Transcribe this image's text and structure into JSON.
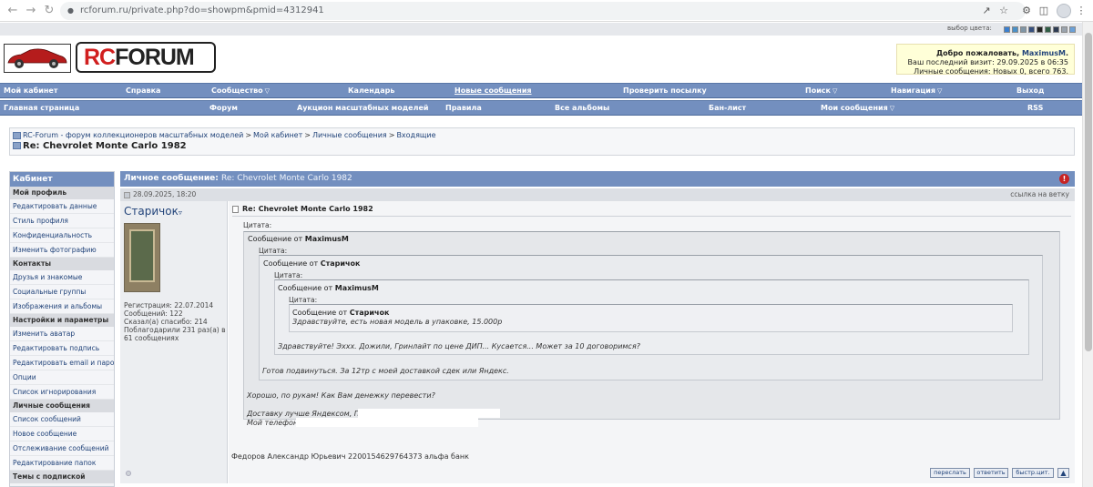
{
  "browser": {
    "back_glyph": "←",
    "forward_glyph": "→",
    "reload_glyph": "↻",
    "url": "rcforum.ru/private.php?do=showpm&pmid=4312941"
  },
  "style_picker": {
    "label": "выбор цвета:",
    "colors": [
      "#3a7fd0",
      "#4a90c8",
      "#7f95a6",
      "#354f7e",
      "#222222",
      "#2f5d45",
      "#2d3b52",
      "#9aa3ad",
      "#6aa0d8"
    ]
  },
  "header": {
    "logo_rc": "RC",
    "logo_forum": "FORUM",
    "welcome_prefix": "Добро пожаловать, ",
    "username": "MaximusM",
    "welcome_suffix": ".",
    "last_visit": "Ваш последний визит: 29.09.2025 в 06:35",
    "messages": "Личные сообщения: Новых 0, всего 763."
  },
  "nav_row1": [
    {
      "label": "Мой кабинет",
      "caret": false,
      "underline": false
    },
    {
      "label": "Справка",
      "caret": false,
      "underline": false
    },
    {
      "label": "Сообщество",
      "caret": true,
      "underline": false
    },
    {
      "label": "Календарь",
      "caret": false,
      "underline": false
    },
    {
      "label": "Новые сообщения",
      "caret": false,
      "underline": true
    },
    {
      "label": "Проверить посылку",
      "caret": false,
      "underline": false
    },
    {
      "label": "Поиск",
      "caret": true,
      "underline": false
    },
    {
      "label": "Навигация",
      "caret": true,
      "underline": false
    },
    {
      "label": "Выход",
      "caret": false,
      "underline": false
    }
  ],
  "nav_row2": [
    {
      "label": "Главная страница",
      "caret": false
    },
    {
      "label": "Форум",
      "caret": false
    },
    {
      "label": "Аукцион масштабных моделей",
      "caret": false
    },
    {
      "label": "Правила",
      "caret": false
    },
    {
      "label": "Все альбомы",
      "caret": false
    },
    {
      "label": "Бан-лист",
      "caret": false
    },
    {
      "label": "Мои сообщения",
      "caret": true
    },
    {
      "label": "RSS",
      "caret": false
    }
  ],
  "breadcrumb": {
    "items": [
      "RC-Forum - форум коллекционеров масштабных моделей",
      "Мой кабинет",
      "Личные сообщения",
      "Входящие"
    ],
    "separator": ">",
    "current": "Re: Chevrolet Monte Carlo 1982"
  },
  "sidebar": {
    "title": "Кабинет",
    "rows": [
      {
        "type": "section",
        "label": "Мой профиль"
      },
      {
        "type": "link",
        "label": "Редактировать данные"
      },
      {
        "type": "link",
        "label": "Стиль профиля"
      },
      {
        "type": "link",
        "label": "Конфиденциальность"
      },
      {
        "type": "link",
        "label": "Изменить фотографию"
      },
      {
        "type": "section",
        "label": "Контакты"
      },
      {
        "type": "link",
        "label": "Друзья и знакомые"
      },
      {
        "type": "link",
        "label": "Социальные группы"
      },
      {
        "type": "link",
        "label": "Изображения и альбомы"
      },
      {
        "type": "section",
        "label": "Настройки и параметры"
      },
      {
        "type": "link",
        "label": "Изменить аватар"
      },
      {
        "type": "link",
        "label": "Редактировать подпись"
      },
      {
        "type": "link",
        "label": "Редактировать email и пароль"
      },
      {
        "type": "link",
        "label": "Опции"
      },
      {
        "type": "link",
        "label": "Список игнорирования"
      },
      {
        "type": "section",
        "label": "Личные сообщения"
      },
      {
        "type": "link",
        "label": "Список сообщений"
      },
      {
        "type": "link",
        "label": "Новое сообщение"
      },
      {
        "type": "link",
        "label": "Отслеживание сообщений"
      },
      {
        "type": "link",
        "label": "Редактирование папок"
      },
      {
        "type": "section",
        "label": "Темы с подпиской"
      }
    ]
  },
  "message": {
    "header_prefix": "Личное сообщение: ",
    "header_subject": "Re: Chevrolet Monte Carlo 1982",
    "warn_glyph": "!",
    "date": "28.09.2025, 18:20",
    "permalink": "ссылка на ветку",
    "author": "Старичок",
    "stats": [
      "Регистрация: 22.07.2014",
      "Сообщений: 122",
      "Сказал(а) спасибо: 214",
      "Поблагодарили 231 раз(а) в 61 сообщениях"
    ],
    "title": "Re: Chevrolet Monte Carlo 1982",
    "quote_label": "Цитата:",
    "from_prefix": "Сообщение от ",
    "quotes": [
      {
        "from": "MaximusM"
      },
      {
        "from": "Старичок"
      },
      {
        "from": "MaximusM"
      },
      {
        "from": "Старичок",
        "text": "Здравствуйте, есть новая модель в упаковке, 15.000р"
      }
    ],
    "q3_text": "Здравствуйте! Эххх. Дожили, Гринлайт по цене ДИП... Кусается... Может за 10 договоримся?",
    "q2_text": "Готов подвинуться. За 12тр с моей доставкой сдек или Яндекс.",
    "q1_text": "Хорошо, по рукам! Как Вам денежку перевести?",
    "q1_delivery": "Доставку лучше Яндексом, ПВЗ",
    "q1_phone": "Мой телефон",
    "reply_text": "Федоров Александр Юрьевич 2200154629764373 альфа банк",
    "buttons": {
      "forward": "переслать",
      "reply": "ответить",
      "quick": "быстр.цит.",
      "up": "▲"
    }
  }
}
